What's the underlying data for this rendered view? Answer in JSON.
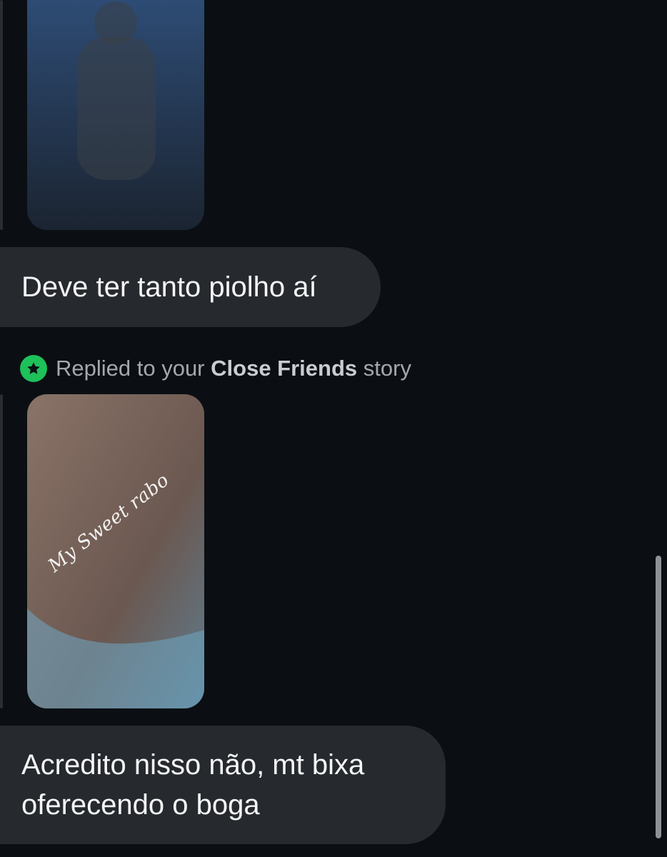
{
  "messages": [
    {
      "type": "story_media",
      "thumbnail": "photo-placeholder"
    },
    {
      "type": "text",
      "text": "Deve ter tanto piolho aí"
    },
    {
      "type": "story_reply_label",
      "prefix": "Replied to your",
      "highlight": "Close Friends",
      "suffix": "story",
      "icon": "star-icon",
      "icon_color": "#1ec15a"
    },
    {
      "type": "story_media",
      "thumbnail": "photo-placeholder",
      "watermark": "My Sweet rabo"
    },
    {
      "type": "text",
      "text": "Acredito nisso não, mt bixa oferecendo o boga"
    }
  ],
  "colors": {
    "background": "#0b0f13",
    "bubble": "#26292d",
    "accent_green": "#1ec15a"
  }
}
